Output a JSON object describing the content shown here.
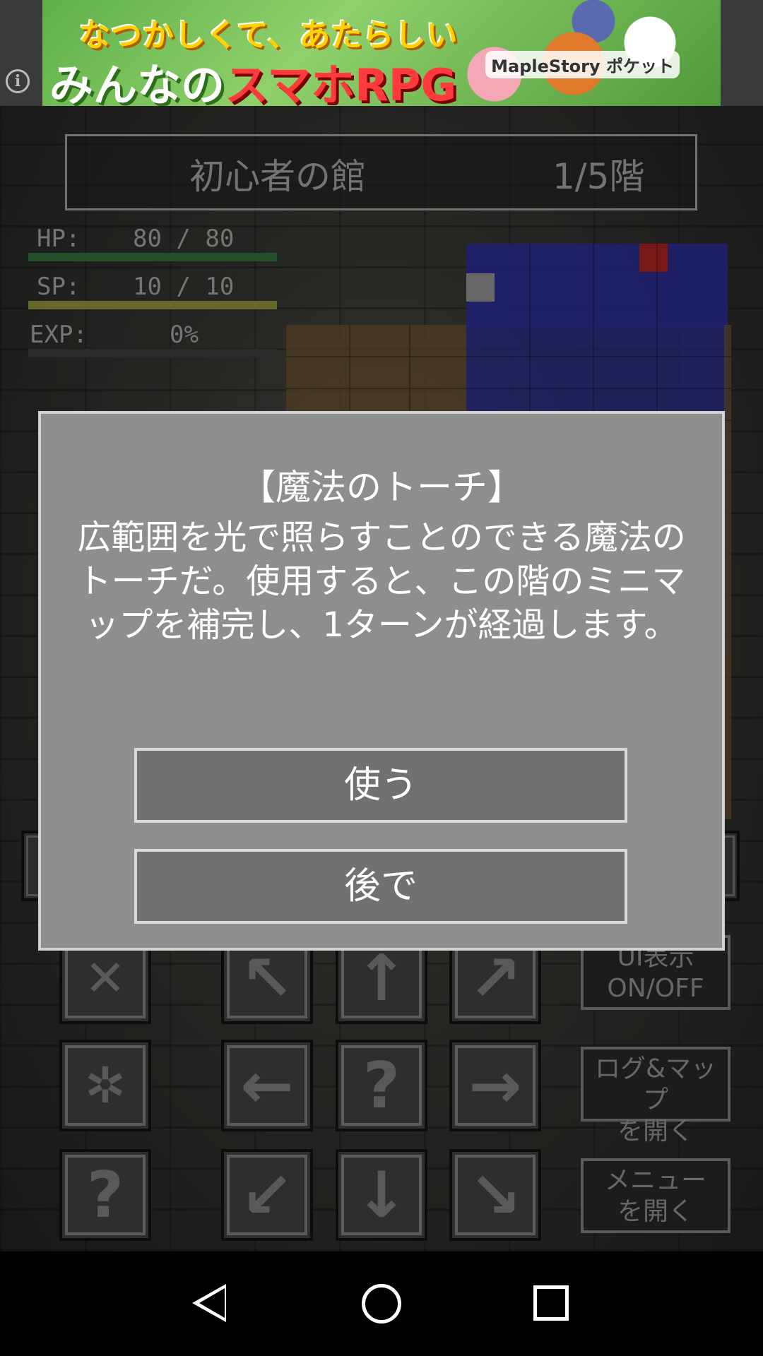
{
  "ad": {
    "line1": "なつかしくて、あたらしい",
    "line2_prefix": "みんなの",
    "line2_highlight": "スマホRPG",
    "brand": "MapleStory ポケット",
    "info_icon": "i"
  },
  "header": {
    "dungeon_name": "初心者の館",
    "floor": "1/5階"
  },
  "stats": {
    "hp_label": "HP:",
    "hp_value": "80 / 80",
    "sp_label": "SP:",
    "sp_value": "10 / 10",
    "exp_label": "EXP:",
    "exp_value": "0%",
    "hp_fill": 1.0,
    "sp_fill": 1.0,
    "exp_fill": 0.0,
    "hp_color": "#2f6a3a",
    "sp_color": "#8a8a3a",
    "exp_color": "#4a4a4a"
  },
  "dialog": {
    "title": "【魔法のトーチ】",
    "body": "広範囲を光で照らすことのできる魔法のトーチだ。使用すると、この階のミニマップを補完し、1ターンが経過します。",
    "use_button": "使う",
    "later_button": "後で"
  },
  "controls": {
    "ui_toggle": "UI表示\nON/OFF",
    "open_log_map": "ログ&マップ\nを開く",
    "open_menu": "メニュー\nを開く",
    "help_glyph": "?",
    "center_glyph": "?"
  },
  "colors": {
    "dialog_bg": "#8e8e8e",
    "dialog_button": "#717171",
    "minimap_blue": "#2a2a9a",
    "minimap_brown": "#6a5030",
    "minimap_red": "#a02020"
  }
}
